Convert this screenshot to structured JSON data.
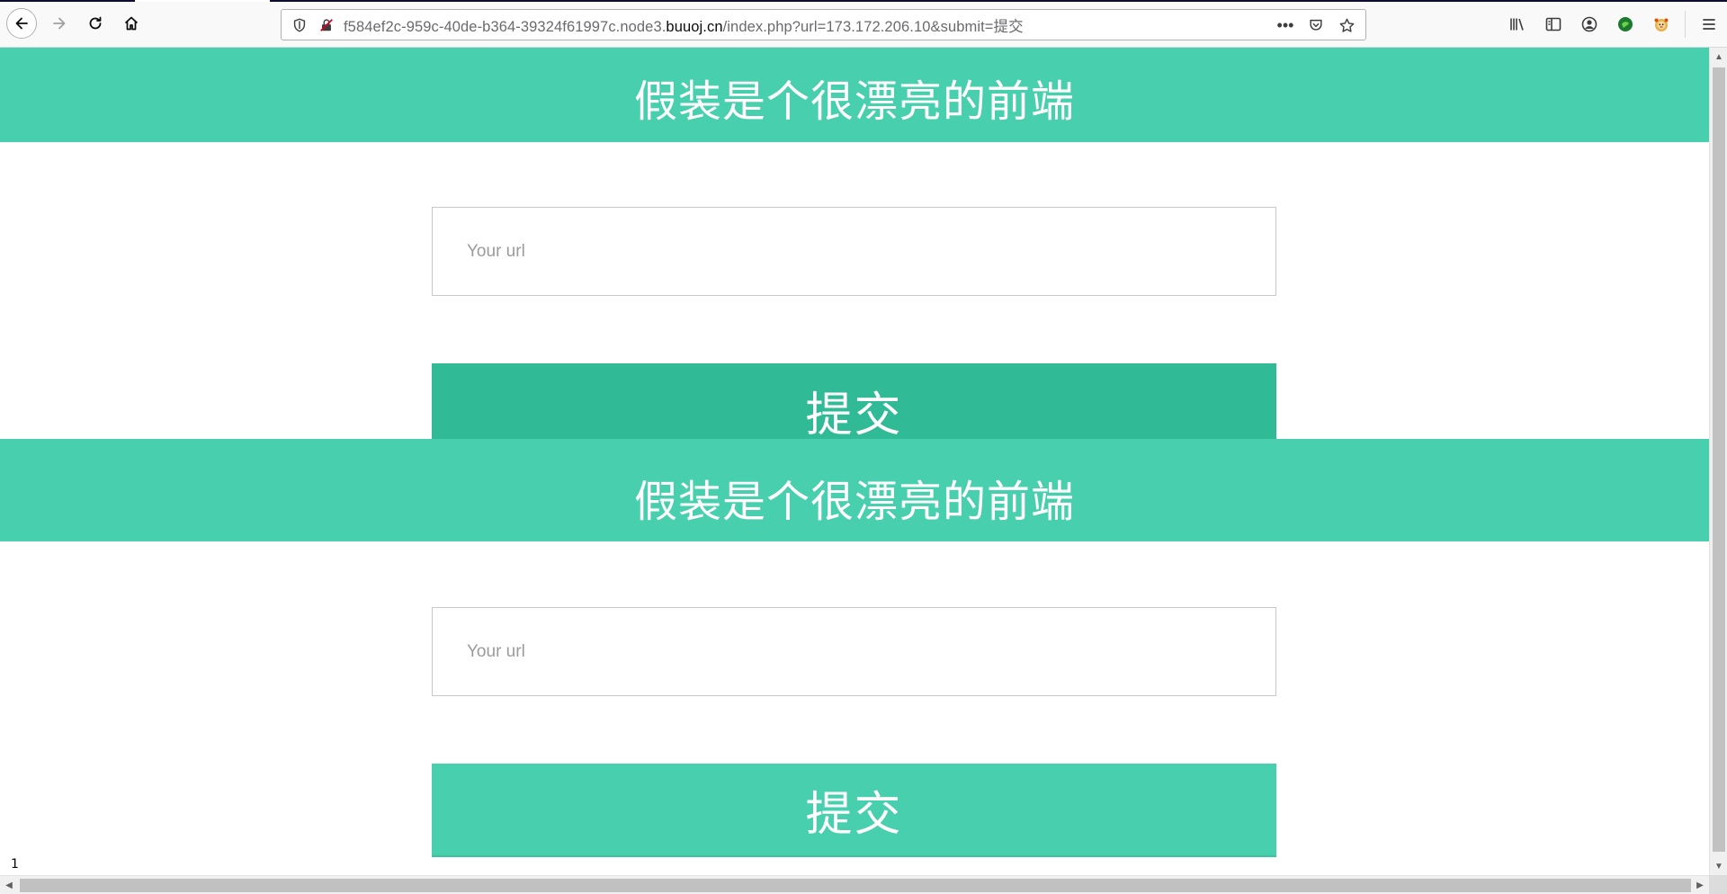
{
  "browser": {
    "url_prefix": "f584ef2c-959c-40de-b364-39324f61997c.node3.",
    "url_host": "buuoj.cn",
    "url_suffix": "/index.php?url=173.172.206.10&submit=提交",
    "icons": {
      "back": "back-arrow-icon",
      "forward": "forward-arrow-icon",
      "reload": "reload-icon",
      "home": "home-icon",
      "tracking": "shield-icon",
      "insecure": "insecure-lock-icon",
      "page_actions": "more-dots-icon",
      "pocket": "pocket-icon",
      "bookmark": "star-icon",
      "library": "library-icon",
      "sidebar": "sidebar-icon",
      "account": "account-icon",
      "extension1": "extension-icon",
      "extension2": "extension-icon",
      "menu": "hamburger-menu-icon"
    }
  },
  "page": {
    "accent_color": "#48cfad",
    "accent_dark": "#30bb96",
    "sections": [
      {
        "title": "假装是个很漂亮的前端",
        "input_placeholder": "Your url",
        "input_value": "",
        "button_label": "提交"
      },
      {
        "title": "假装是个很漂亮的前端",
        "input_placeholder": "Your url",
        "input_value": "",
        "button_label": "提交"
      }
    ],
    "stray_output": "1"
  }
}
